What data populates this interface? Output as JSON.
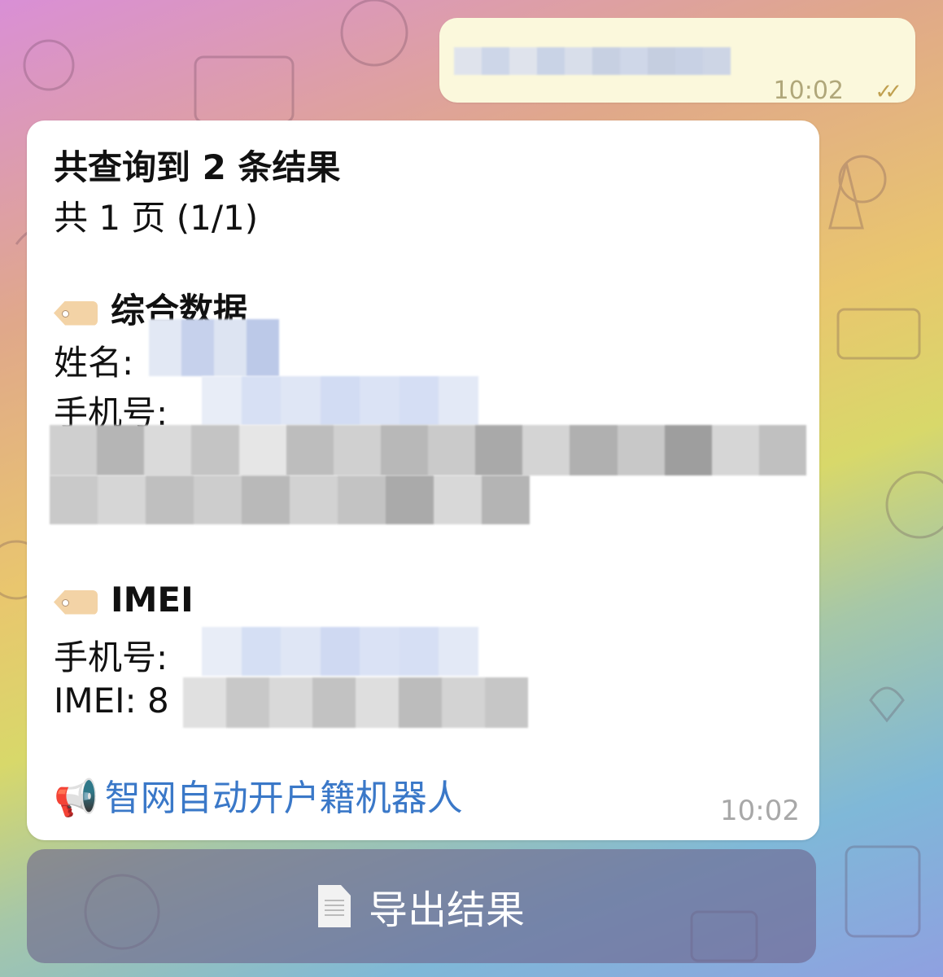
{
  "outgoing": {
    "time": "10:02",
    "status": "read"
  },
  "result": {
    "heading": "共查询到 2 条结果",
    "pages": "共 1 页 (1/1)",
    "section1": {
      "title": "综合数据",
      "name_label": "姓名:",
      "phone_label": "手机号:"
    },
    "section2": {
      "title": "IMEI",
      "phone_label": "手机号:",
      "imei_label": "IMEI: 8"
    },
    "bot_link": "智网自动开户籍机器人",
    "time": "10:02"
  },
  "export_button": {
    "label": "导出结果"
  },
  "icons": {
    "tag": "tag-icon",
    "megaphone": "megaphone-icon",
    "document": "document-icon",
    "read": "double-check-icon"
  }
}
